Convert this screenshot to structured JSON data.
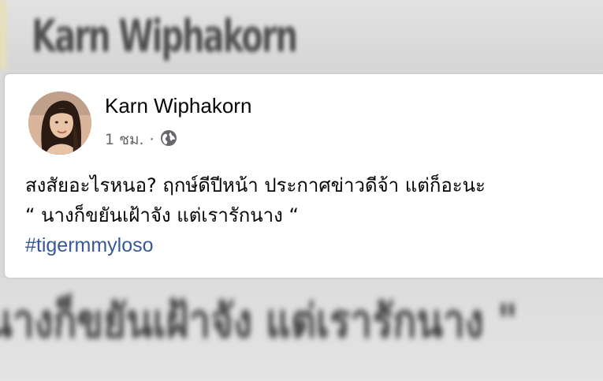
{
  "background": {
    "top_blurred_name": "Karn Wiphakorn",
    "bottom_blurred_text": "นางก็ขยันเฝ้าจัง แต่เรารักนาง \""
  },
  "post": {
    "author_name": "Karn Wiphakorn",
    "timestamp": "1 ชม.",
    "separator": "·",
    "audience_icon": "globe-icon",
    "lines": [
      "สงสัยอะไรหนอ? ฤกษ์ดีปีหน้า ประกาศข่าวดีจ้า แต่ก็อะนะ",
      "“ นางก็ขยันเฝ้าจัง แต่เรารักนาง “"
    ],
    "hashtag": "#tigermmyloso",
    "colors": {
      "link": "#385898",
      "meta": "#65676b",
      "text": "#050505"
    }
  }
}
